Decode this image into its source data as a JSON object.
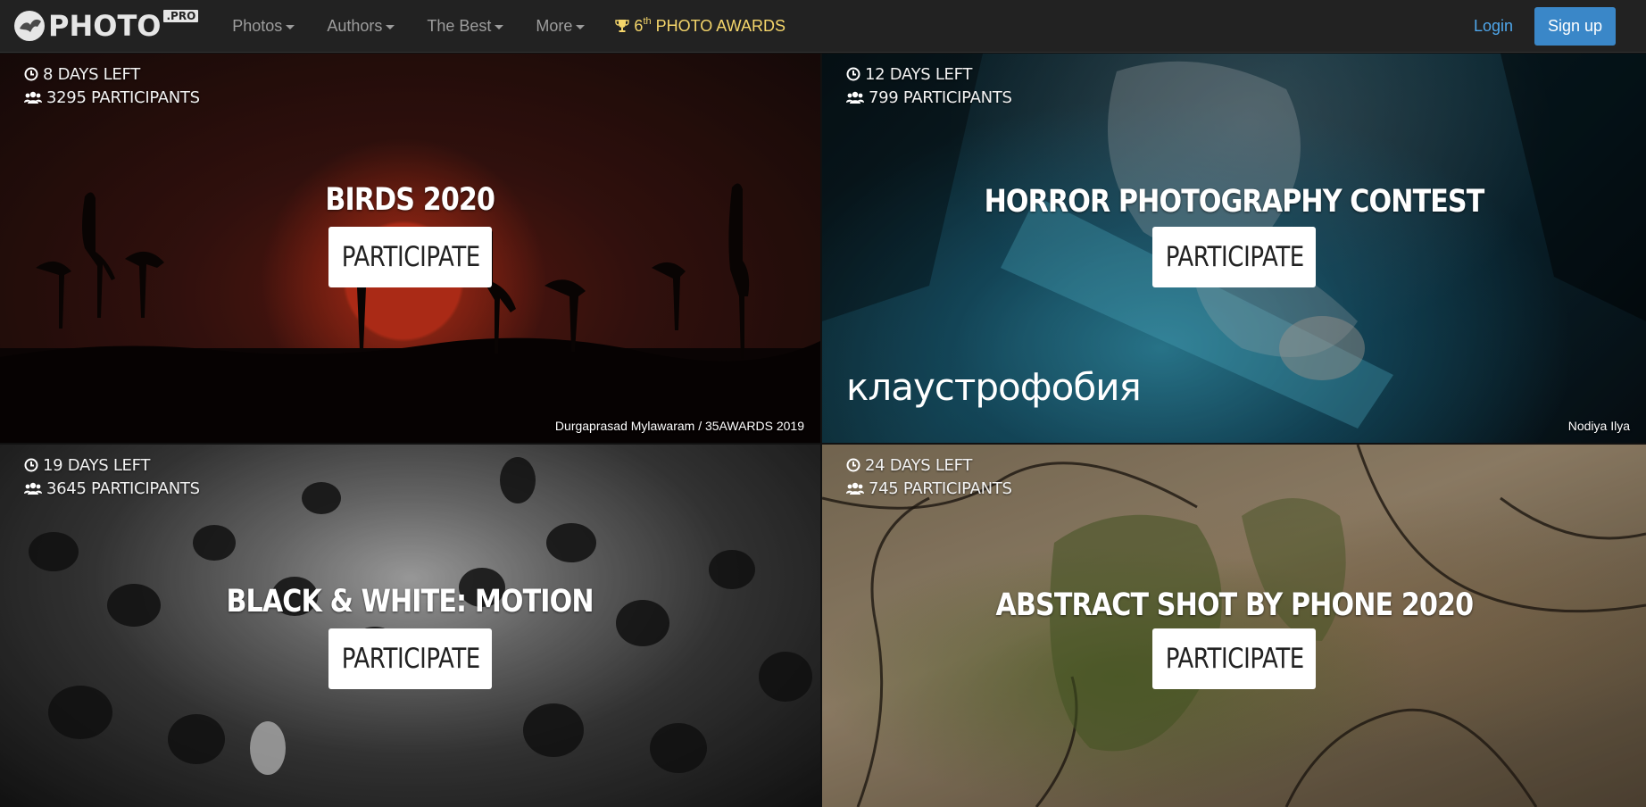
{
  "brand": {
    "name": "PHOTO",
    "suffix": ".PRO"
  },
  "nav": {
    "items": [
      {
        "label": "Photos"
      },
      {
        "label": "Authors"
      },
      {
        "label": "The Best"
      },
      {
        "label": "More"
      }
    ],
    "awards": {
      "number": "6",
      "ordinal": "th",
      "label": "PHOTO AWARDS"
    },
    "login": "Login",
    "signup": "Sign up"
  },
  "contests": [
    {
      "days_left": "8 DAYS LEFT",
      "participants": "3295 PARTICIPANTS",
      "title": "BIRDS 2020",
      "button": "PARTICIPATE",
      "credit": "Durgaprasad Mylawaram / 35AWARDS 2019"
    },
    {
      "days_left": "12 DAYS LEFT",
      "participants": "799 PARTICIPANTS",
      "title": "HORROR PHOTOGRAPHY CONTEST",
      "button": "PARTICIPATE",
      "credit": "Nodiya Ilya",
      "watermark": "клаустрофобия"
    },
    {
      "days_left": "19 DAYS LEFT",
      "participants": "3645 PARTICIPANTS",
      "title": "BLACK & WHITE: MOTION",
      "button": "PARTICIPATE"
    },
    {
      "days_left": "24 DAYS LEFT",
      "participants": "745 PARTICIPANTS",
      "title": "ABSTRACT SHOT BY PHONE 2020",
      "button": "PARTICIPATE"
    }
  ],
  "icons": {
    "clock": "clock-icon",
    "users": "users-icon",
    "trophy": "trophy-icon"
  },
  "colors": {
    "navbar": "#222222",
    "nav_text": "#9d9d9d",
    "awards": "#f5d66b",
    "login": "#4fa7ec",
    "signup": "#3a87c8"
  }
}
